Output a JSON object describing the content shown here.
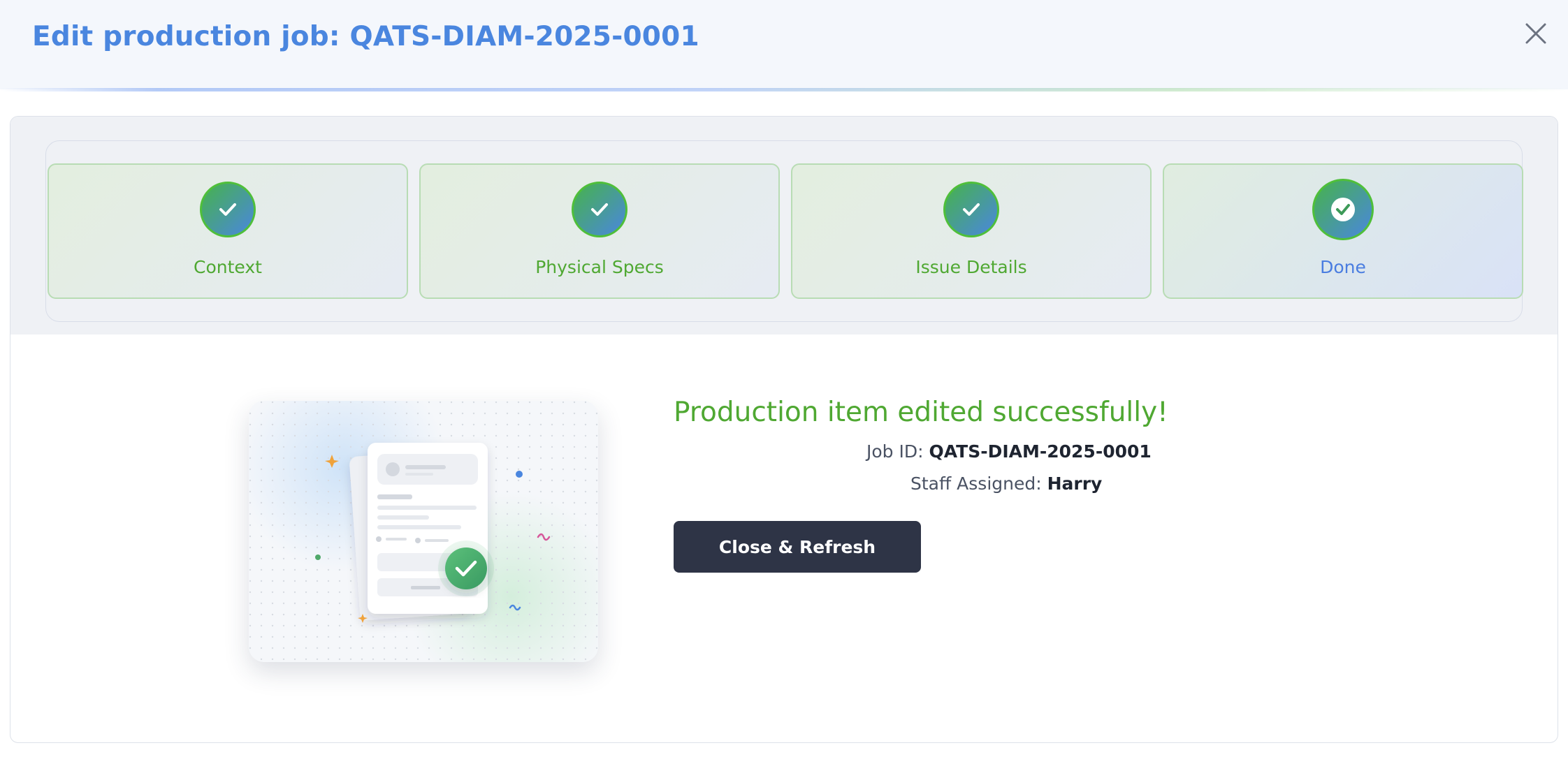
{
  "modal": {
    "title": "Edit production job: QATS-DIAM-2025-0001",
    "close_icon": "close-icon"
  },
  "stepper": {
    "steps": [
      {
        "label": "Context",
        "status": "complete",
        "icon": "check-icon"
      },
      {
        "label": "Physical Specs",
        "status": "complete",
        "icon": "check-icon"
      },
      {
        "label": "Issue Details",
        "status": "complete",
        "icon": "check-icon"
      },
      {
        "label": "Done",
        "status": "current",
        "icon": "check-circle-icon"
      }
    ]
  },
  "result": {
    "heading": "Production item edited successfully!",
    "job_id_label": "Job ID:",
    "job_id_value": "QATS-DIAM-2025-0001",
    "staff_label": "Staff Assigned:",
    "staff_value": "Harry",
    "close_refresh_label": "Close & Refresh"
  },
  "colors": {
    "title": "#4a86df",
    "success": "#4fa832",
    "step_done_label": "#4a7de0",
    "button_bg": "#2e3446"
  }
}
